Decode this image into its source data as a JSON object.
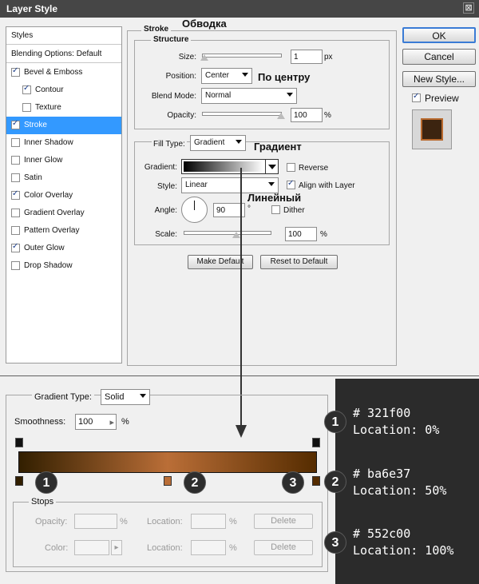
{
  "window": {
    "title": "Layer Style",
    "close_glyph": "⊠"
  },
  "styles_panel": {
    "header": "Styles",
    "blending": "Blending Options: Default",
    "items": [
      {
        "label": "Bevel & Emboss",
        "checked": true
      },
      {
        "label": "Contour",
        "checked": true
      },
      {
        "label": "Texture",
        "checked": false
      },
      {
        "label": "Stroke",
        "checked": true
      },
      {
        "label": "Inner Shadow",
        "checked": false
      },
      {
        "label": "Inner Glow",
        "checked": false
      },
      {
        "label": "Satin",
        "checked": false
      },
      {
        "label": "Color Overlay",
        "checked": true
      },
      {
        "label": "Gradient Overlay",
        "checked": false
      },
      {
        "label": "Pattern Overlay",
        "checked": false
      },
      {
        "label": "Outer Glow",
        "checked": true
      },
      {
        "label": "Drop Shadow",
        "checked": false
      }
    ],
    "selected": "Stroke"
  },
  "stroke": {
    "title": "Stroke",
    "annotation": "Обводка",
    "structure": {
      "title": "Structure",
      "size_label": "Size:",
      "size_value": "1",
      "size_unit": "px",
      "position_label": "Position:",
      "position_value": "Center",
      "position_annotation": "По центру",
      "blend_label": "Blend Mode:",
      "blend_value": "Normal",
      "opacity_label": "Opacity:",
      "opacity_value": "100",
      "opacity_unit": "%"
    },
    "fill": {
      "filltype_label": "Fill Type:",
      "filltype_value": "Gradient",
      "filltype_annotation": "Градиент",
      "gradient_label": "Gradient:",
      "reverse_label": "Reverse",
      "reverse_checked": false,
      "style_label": "Style:",
      "style_value": "Linear",
      "style_annotation": "Линейный",
      "align_label": "Align with Layer",
      "align_checked": true,
      "angle_label": "Angle:",
      "angle_value": "90",
      "angle_unit": "°",
      "dither_label": "Dither",
      "dither_checked": false,
      "scale_label": "Scale:",
      "scale_value": "100",
      "scale_unit": "%"
    },
    "make_default": "Make Default",
    "reset_default": "Reset to Default"
  },
  "buttons": {
    "ok": "OK",
    "cancel": "Cancel",
    "new_style": "New Style...",
    "preview_label": "Preview",
    "preview_checked": true
  },
  "gradient_editor": {
    "type_label": "Gradient Type:",
    "type_value": "Solid",
    "smooth_label": "Smoothness:",
    "smooth_value": "100",
    "smooth_unit": "%",
    "stops_title": "Stops",
    "opacity_label": "Opacity:",
    "opacity_unit": "%",
    "location_label": "Location:",
    "location_unit": "%",
    "delete_label": "Delete",
    "color_label": "Color:",
    "color_stops": [
      {
        "color": "#321f00",
        "location": 0,
        "badge": "1"
      },
      {
        "color": "#ba6e37",
        "location": 50,
        "badge": "2"
      },
      {
        "color": "#552c00",
        "location": 100,
        "badge": "3"
      }
    ]
  },
  "info": [
    {
      "badge": "1",
      "hex": "# 321f00",
      "loc": "Location: 0%"
    },
    {
      "badge": "2",
      "hex": "# ba6e37",
      "loc": "Location: 50%"
    },
    {
      "badge": "3",
      "hex": "# 552c00",
      "loc": "Location: 100%"
    }
  ]
}
